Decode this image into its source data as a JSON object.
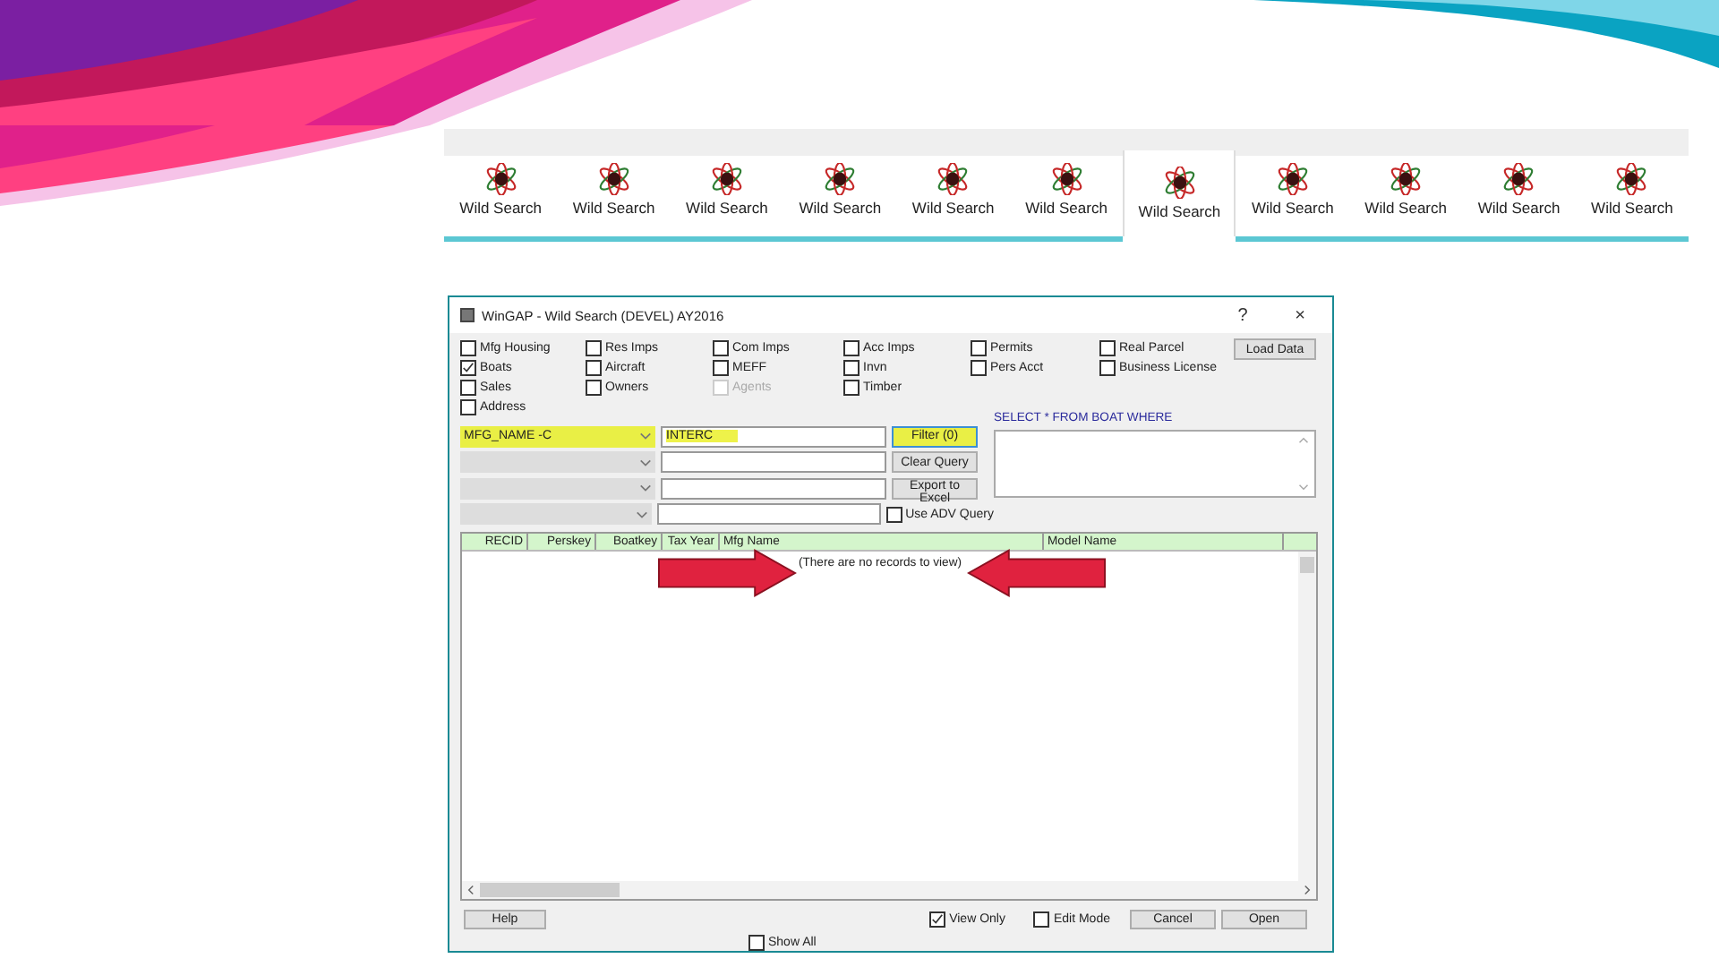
{
  "tab_strip": {
    "items": [
      {
        "label": "Wild Search",
        "selected": false
      },
      {
        "label": "Wild Search",
        "selected": false
      },
      {
        "label": "Wild Search",
        "selected": false
      },
      {
        "label": "Wild Search",
        "selected": false
      },
      {
        "label": "Wild Search",
        "selected": false
      },
      {
        "label": "Wild Search",
        "selected": false
      },
      {
        "label": "Wild Search",
        "selected": true
      },
      {
        "label": "Wild Search",
        "selected": false
      },
      {
        "label": "Wild Search",
        "selected": false
      },
      {
        "label": "Wild Search",
        "selected": false
      },
      {
        "label": "Wild Search",
        "selected": false
      }
    ]
  },
  "window": {
    "title": "WinGAP - Wild Search (DEVEL) AY2016",
    "help": "?",
    "close": "×"
  },
  "filters": [
    [
      {
        "label": "Mfg Housing",
        "checked": false,
        "disabled": false
      },
      {
        "label": "Boats",
        "checked": true,
        "disabled": false
      },
      {
        "label": "Sales",
        "checked": false,
        "disabled": false
      },
      {
        "label": "Address",
        "checked": false,
        "disabled": false
      }
    ],
    [
      {
        "label": "Res Imps",
        "checked": false,
        "disabled": false
      },
      {
        "label": "Aircraft",
        "checked": false,
        "disabled": false
      },
      {
        "label": "Owners",
        "checked": false,
        "disabled": false
      }
    ],
    [
      {
        "label": "Com Imps",
        "checked": false,
        "disabled": false
      },
      {
        "label": "MEFF",
        "checked": false,
        "disabled": false
      },
      {
        "label": "Agents",
        "checked": false,
        "disabled": true
      }
    ],
    [
      {
        "label": "Acc Imps",
        "checked": false,
        "disabled": false
      },
      {
        "label": "Invn",
        "checked": false,
        "disabled": false
      },
      {
        "label": "Timber",
        "checked": false,
        "disabled": false
      }
    ],
    [
      {
        "label": "Permits",
        "checked": false,
        "disabled": false
      },
      {
        "label": "Pers Acct",
        "checked": false,
        "disabled": false
      }
    ],
    [
      {
        "label": "Real Parcel",
        "checked": false,
        "disabled": false
      },
      {
        "label": "Business License",
        "checked": false,
        "disabled": false
      }
    ]
  ],
  "load_button": "Load Data",
  "query_rows": [
    {
      "field": "MFG_NAME -C",
      "value": "INTERC",
      "highlighted": true
    },
    {
      "highlighted": false
    },
    {
      "highlighted": false
    },
    {
      "highlighted": false
    }
  ],
  "actions": [
    {
      "kind": "button",
      "label": "Filter (0)",
      "highlighted": true
    },
    {
      "kind": "button",
      "label": "Clear Query",
      "highlighted": false
    },
    {
      "kind": "button",
      "label": "Export to Excel",
      "highlighted": false
    },
    {
      "kind": "checkbox",
      "label": "Use ADV Query",
      "checked": false
    }
  ],
  "sql": {
    "label": "SELECT * FROM BOAT WHERE"
  },
  "grid": {
    "columns": [
      "RECID",
      "Perskey",
      "Boatkey",
      "Tax Year",
      "Mfg Name",
      "Model Name"
    ],
    "message": "(There are no records to view)"
  },
  "footer": {
    "help": "Help",
    "view_only": {
      "label": "View Only",
      "checked": true
    },
    "edit_mode": {
      "label": "Edit Mode",
      "checked": false
    },
    "cancel": "Cancel",
    "open": "Open",
    "show_all": {
      "label": "Show All",
      "checked": false
    }
  }
}
